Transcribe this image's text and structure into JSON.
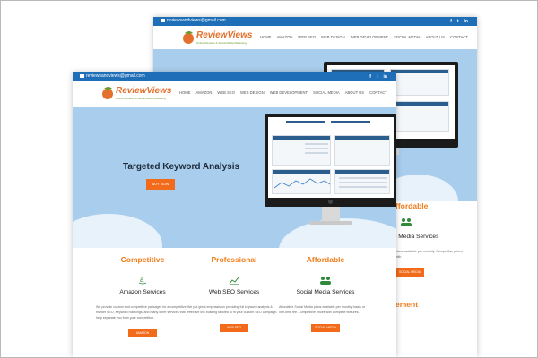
{
  "email": "reviewsandviews@gmail.com",
  "logo": {
    "word": "ReviewViews",
    "tagline": "Online Reviews & Social Media Marketing"
  },
  "social": [
    "f",
    "t",
    "in"
  ],
  "menu": [
    "HOME",
    "AMAZON",
    "WEB SEO",
    "WEB DESIGN",
    "WEB DEVELOPMENT",
    "SOCIAL MEDIA",
    "ABOUT US",
    "CONTACT"
  ],
  "hero": {
    "title": "Targeted Keyword Analysis",
    "button": "BUY NOW"
  },
  "features": [
    {
      "heading": "Competitive",
      "icon": "amazon-icon",
      "title": "Amazon Services",
      "text": "We provide custom and competitive packages for a competitive market SEO, Keyword Rankings, and many other services that help separate you from your competition.",
      "button": "AMAZON"
    },
    {
      "heading": "Professional",
      "icon": "chart-icon",
      "title": "Web SEO Services",
      "text": "We put great emphasis on providing full keyword analysis & effective link building tailored to fit your custom SEO campaign.",
      "button": "WEB SEO"
    },
    {
      "heading": "Affordable",
      "icon": "people-icon",
      "title": "Social Media Services",
      "text": "Affordable Social Media plans available per monthly basis or one-time fee. Competitive prices with complete features.",
      "button": "SOCIAL MEDIA"
    }
  ],
  "back_page": {
    "affordable": "ffordable",
    "social_title": "l Media Services",
    "social_text": "plans available per monthly. Competitive prices with",
    "social_button": "SOCIAL MEDIA",
    "next_heading": "ement"
  },
  "colors": {
    "topbar": "#1e6fb7",
    "accent": "#f26b1a",
    "heading": "#f07d1a",
    "hero": "#a9cdec"
  }
}
